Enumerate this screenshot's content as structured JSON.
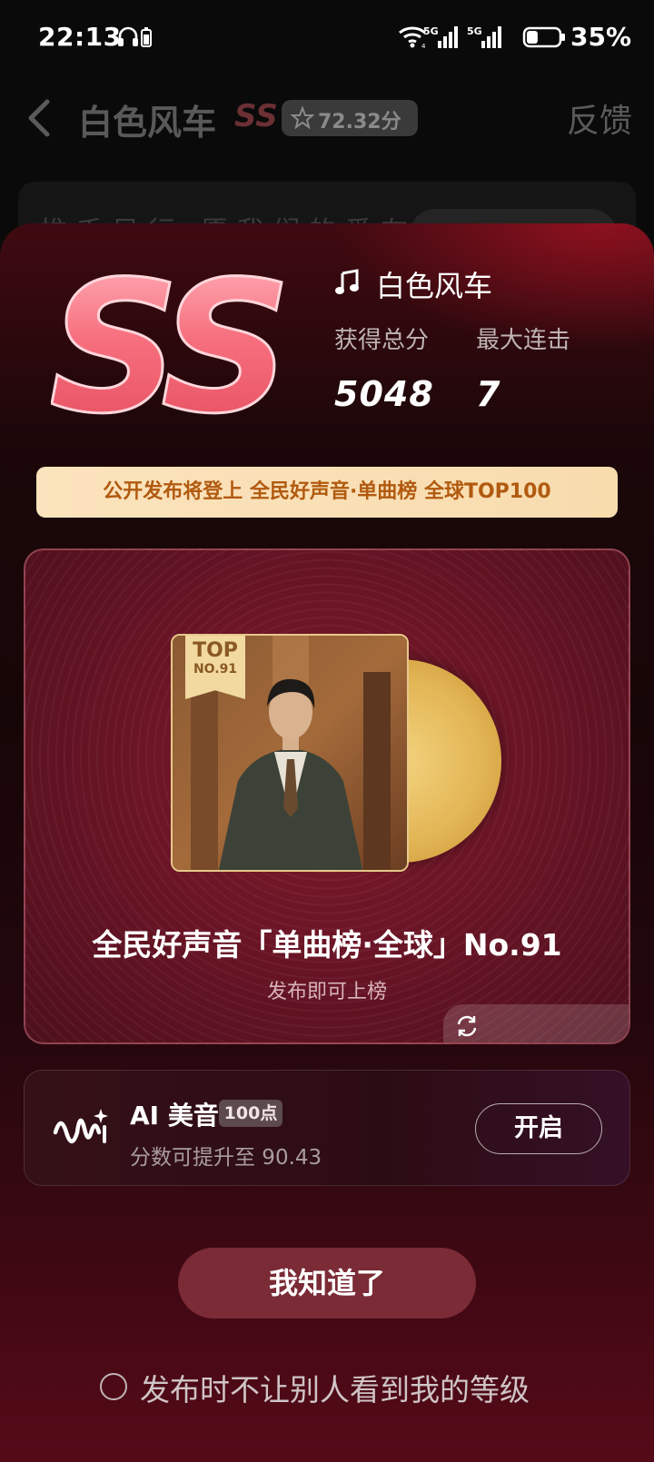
{
  "status_bar": {
    "time": "22:13",
    "network_1": "5G",
    "network_2": "5G",
    "battery_percent": "35%",
    "battery_level": 0.35
  },
  "header": {
    "song_title": "白色风车",
    "grade": "SS",
    "score": "72.32分",
    "feedback_label": "反馈"
  },
  "background_card": {
    "text": "推 千 风 行 · 愿 我 们 的 爱 在 时"
  },
  "sheet": {
    "grade_badge": "SS",
    "song_name": "白色风车",
    "stats": [
      {
        "label": "获得总分",
        "value": "5048"
      },
      {
        "label": "最大连击",
        "value": "7"
      }
    ],
    "promo_banner": "公开发布将登上 全民好声音·单曲榜 全球TOP100",
    "chart_card": {
      "tag_line1": "TOP",
      "tag_line2": "NO.91",
      "title": "全民好声音「单曲榜·全球」No.91",
      "subtitle": "发布即可上榜"
    },
    "ai_card": {
      "title": "AI 美音",
      "badge": "100点",
      "description": "分数可提升至 90.43",
      "button_label": "开启"
    },
    "ok_button": "我知道了",
    "hide_level_label": "发布时不让别人看到我的等级"
  },
  "colors": {
    "sheet_top": "#3f0a11",
    "sheet_bottom": "#560a18",
    "banner_bg": "#fbe3bd",
    "banner_text": "#b15a10",
    "grade_pink": "#f26a7a"
  }
}
